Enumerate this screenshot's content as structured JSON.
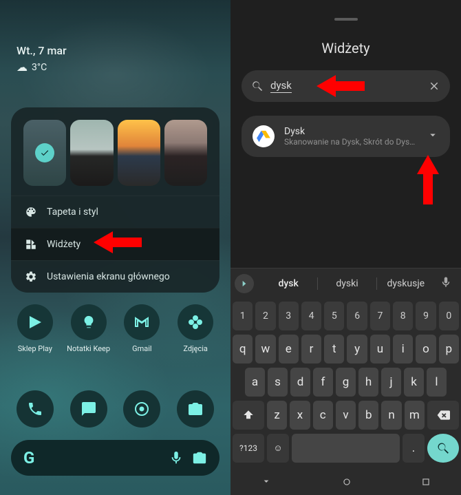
{
  "left": {
    "date": "Wt., 7 mar",
    "temperature": "3°C",
    "menu": {
      "item0": "Tapeta i styl",
      "item1": "Widżety",
      "item2": "Ustawienia ekranu głównego"
    },
    "apps": {
      "a0": "Sklep Play",
      "a1": "Notatki Keep",
      "a2": "Gmail",
      "a3": "Zdjęcia"
    }
  },
  "right": {
    "title": "Widżety",
    "search_value": "dysk",
    "result": {
      "title": "Dysk",
      "subtitle": "Skanowanie na Dysk, Skrót do Dysku..."
    },
    "suggestions": {
      "s0": "dysk",
      "s1": "dyski",
      "s2": "dyskusje"
    },
    "keys": {
      "numrow": [
        "1",
        "2",
        "3",
        "4",
        "5",
        "6",
        "7",
        "8",
        "9",
        "0"
      ],
      "row1": [
        "q",
        "w",
        "e",
        "r",
        "t",
        "y",
        "u",
        "i",
        "o",
        "p"
      ],
      "row2": [
        "a",
        "s",
        "d",
        "f",
        "g",
        "h",
        "j",
        "k",
        "l"
      ],
      "row3": [
        "z",
        "x",
        "c",
        "v",
        "b",
        "n",
        "m"
      ],
      "symkey": "?123"
    }
  }
}
